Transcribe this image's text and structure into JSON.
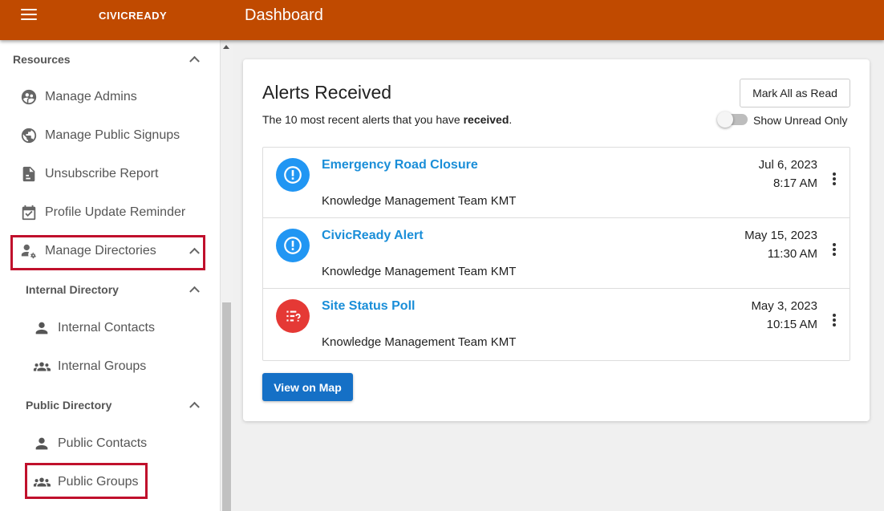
{
  "header": {
    "logo": "CIVICREADY",
    "title": "Dashboard"
  },
  "sidebar": {
    "resources_label": "Resources",
    "items": [
      {
        "label": "Manage Admins",
        "icon": "admins-icon"
      },
      {
        "label": "Manage Public Signups",
        "icon": "globe-icon"
      },
      {
        "label": "Unsubscribe Report",
        "icon": "report-icon"
      },
      {
        "label": "Profile Update Reminder",
        "icon": "calendar-check-icon"
      },
      {
        "label": "Manage Directories",
        "icon": "user-gear-icon"
      }
    ],
    "internal_directory": {
      "label": "Internal Directory",
      "items": [
        {
          "label": "Internal Contacts",
          "icon": "person-icon"
        },
        {
          "label": "Internal Groups",
          "icon": "group-icon"
        }
      ]
    },
    "public_directory": {
      "label": "Public Directory",
      "items": [
        {
          "label": "Public Contacts",
          "icon": "person-icon"
        },
        {
          "label": "Public Groups",
          "icon": "group-icon"
        }
      ]
    },
    "highlight_color": "#c0102c"
  },
  "main": {
    "title": "Alerts Received",
    "subtitle_prefix": "The 10 most recent alerts that you have ",
    "subtitle_bold": "received",
    "subtitle_suffix": ".",
    "mark_all_label": "Mark All as Read",
    "toggle_label": "Show Unread Only",
    "toggle_on": false,
    "alerts": [
      {
        "title": "Emergency Road Closure",
        "from": "Knowledge Management Team KMT",
        "date": "Jul 6, 2023",
        "time": "8:17 AM",
        "icon": "alert-exclamation-icon",
        "color": "#2196f3"
      },
      {
        "title": "CivicReady Alert",
        "from": "Knowledge Management Team KMT",
        "date": "May 15, 2023",
        "time": "11:30 AM",
        "icon": "alert-exclamation-icon",
        "color": "#2196f3"
      },
      {
        "title": "Site Status Poll",
        "from": "Knowledge Management Team KMT",
        "date": "May 3, 2023",
        "time": "10:15 AM",
        "icon": "poll-icon",
        "color": "#e53935"
      }
    ],
    "map_button_label": "View on Map"
  },
  "colors": {
    "header_bg": "#c04a00",
    "link": "#1a8ed8",
    "primary_button": "#1570c6"
  }
}
